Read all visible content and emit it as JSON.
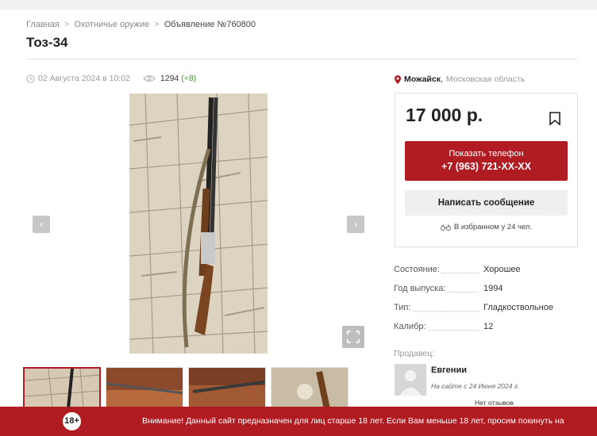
{
  "breadcrumbs": {
    "home": "Главная",
    "category": "Охотничье оружие",
    "current": "Объявление №760800"
  },
  "listing": {
    "title": "Тоз-34",
    "date": "02 Августа 2024 в 10:02",
    "views": "1294",
    "views_delta": "(+8)"
  },
  "location": {
    "city": "Можайск",
    "region": "Московская область"
  },
  "card": {
    "price": "17 000 р.",
    "phone_label": "Показать телефон",
    "phone_number": "+7 (963) 721-XX-XX",
    "message_label": "Написать сообщение",
    "favorites": "В избранном у 24 чел."
  },
  "specs": [
    {
      "key": "Состояние:",
      "value": "Хорошее"
    },
    {
      "key": "Год выпуска:",
      "value": "1994"
    },
    {
      "key": "Тип:",
      "value": "Гладкоствольное"
    },
    {
      "key": "Калибр:",
      "value": "12"
    }
  ],
  "seller": {
    "label": "Продавец:",
    "name": "Евгении",
    "since": "На сайте с 24 Июня 2024 г.",
    "reviews": "Нет отзывов"
  },
  "footer": {
    "badge": "18+",
    "warning": "Внимание! Данный сайт предназначен для лиц старше 18 лет. Если Вам меньше 18 лет, просим покинуть на"
  },
  "icons": {
    "prev": "chevron-left-icon",
    "next": "chevron-right-icon",
    "fullscreen": "fullscreen-icon",
    "bookmark": "bookmark-icon",
    "location": "map-pin-icon",
    "clock": "clock-icon",
    "eye": "eye-icon",
    "binoculars": "binoculars-icon"
  },
  "colors": {
    "accent": "#b01c22",
    "views_delta": "#3a9a2a"
  }
}
